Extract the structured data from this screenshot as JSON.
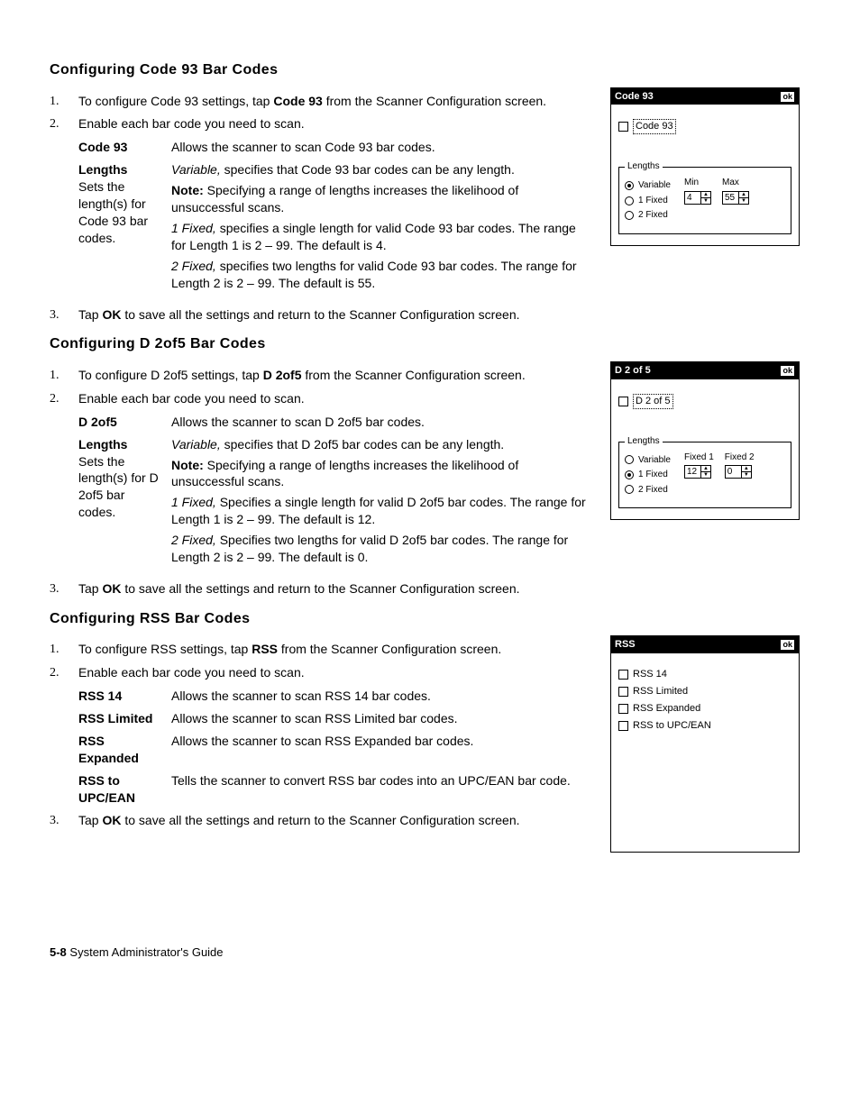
{
  "footer": {
    "page": "5-8",
    "title": "System Administrator's Guide"
  },
  "sections": [
    {
      "title": "Configuring Code 93 Bar Codes",
      "steps": {
        "s1": {
          "pre": "To configure Code 93 settings, tap ",
          "bold": "Code 93",
          "post": " from the Scanner Configuration screen."
        },
        "s2": "Enable each bar code you need to scan.",
        "s3": {
          "pre": "Tap ",
          "bold": "OK",
          "post": " to save all the settings and return to the Scanner Configuration screen."
        }
      },
      "defs": {
        "r1": {
          "term": "Code 93",
          "desc": "Allows the scanner to scan Code 93 bar codes."
        },
        "r2": {
          "term": "Lengths",
          "termExtra": "Sets the length(s) for Code 93 bar codes.",
          "p1_em": "Variable,",
          "p1_rest": " specifies that Code 93 bar codes can be any length.",
          "note_b": "Note:",
          "note_rest": " Specifying a range of lengths increases the likelihood of unsuccessful scans.",
          "p2_em": "1 Fixed,",
          "p2_rest": " specifies a single length for valid Code 93 bar codes.  The range for Length 1 is 2 – 99.  The default is 4.",
          "p3_em": "2 Fixed,",
          "p3_rest": " specifies two lengths for valid Code 93 bar codes.  The range for Length 2 is 2 – 99.  The default is 55."
        }
      },
      "dialog": {
        "title": "Code 93",
        "ok": "ok",
        "checkbox": "Code 93",
        "legend": "Lengths",
        "radios": [
          "Variable",
          "1 Fixed",
          "2 Fixed"
        ],
        "selected": 0,
        "spin1": {
          "label": "Min",
          "value": "4"
        },
        "spin2": {
          "label": "Max",
          "value": "55"
        }
      }
    },
    {
      "title": "Configuring D 2of5 Bar Codes",
      "steps": {
        "s1": {
          "pre": "To configure D 2of5 settings, tap ",
          "bold": "D 2of5",
          "post": " from the Scanner Configuration screen."
        },
        "s2": "Enable each bar code you need to scan.",
        "s3": {
          "pre": "Tap ",
          "bold": "OK",
          "post": " to save all the settings and return to the Scanner Configuration screen."
        }
      },
      "defs": {
        "r1": {
          "term": "D 2of5",
          "desc": "Allows the scanner to scan D 2of5 bar codes."
        },
        "r2": {
          "term": "Lengths",
          "termExtra": "Sets the length(s) for D 2of5 bar codes.",
          "p1_em": "Variable,",
          "p1_rest": " specifies that D 2of5 bar codes can be any length.",
          "note_b": "Note:",
          "note_rest": " Specifying a range of lengths increases the likelihood of unsuccessful scans.",
          "p2_em": "1 Fixed,",
          "p2_rest": " Specifies a single length for valid D 2of5 bar codes.  The range for Length 1 is 2 – 99.  The default is 12.",
          "p3_em": "2 Fixed,",
          "p3_rest": " Specifies two lengths for valid D 2of5 bar codes.  The range for Length 2 is 2 – 99.  The default is 0."
        }
      },
      "dialog": {
        "title": "D 2 of 5",
        "ok": "ok",
        "checkbox": "D 2 of 5",
        "legend": "Lengths",
        "radios": [
          "Variable",
          "1 Fixed",
          "2 Fixed"
        ],
        "selected": 1,
        "spin1": {
          "label": "Fixed 1",
          "value": "12"
        },
        "spin2": {
          "label": "Fixed 2",
          "value": "0"
        }
      }
    },
    {
      "title": "Configuring RSS Bar Codes",
      "steps": {
        "s1": {
          "pre": "To configure RSS settings, tap ",
          "bold": "RSS",
          "post": " from the Scanner Configuration screen."
        },
        "s2": "Enable each bar code you need to scan.",
        "s3": {
          "pre": "Tap ",
          "bold": "OK",
          "post": " to save all the settings and return to the Scanner Configuration screen."
        }
      },
      "defs": {
        "r1": {
          "term": "RSS 14",
          "desc": "Allows the scanner to scan RSS 14 bar codes."
        },
        "r2": {
          "term": "RSS Limited",
          "desc": "Allows the scanner to scan RSS Limited bar codes."
        },
        "r3": {
          "term": "RSS Expanded",
          "desc": "Allows the scanner to scan RSS Expanded bar codes."
        },
        "r4": {
          "term": "RSS to UPC/EAN",
          "desc": "Tells the scanner to convert RSS bar codes into an UPC/EAN bar code."
        }
      },
      "dialog": {
        "title": "RSS",
        "ok": "ok",
        "checkboxes": [
          "RSS 14",
          "RSS Limited",
          "RSS Expanded",
          "RSS to UPC/EAN"
        ]
      }
    }
  ]
}
